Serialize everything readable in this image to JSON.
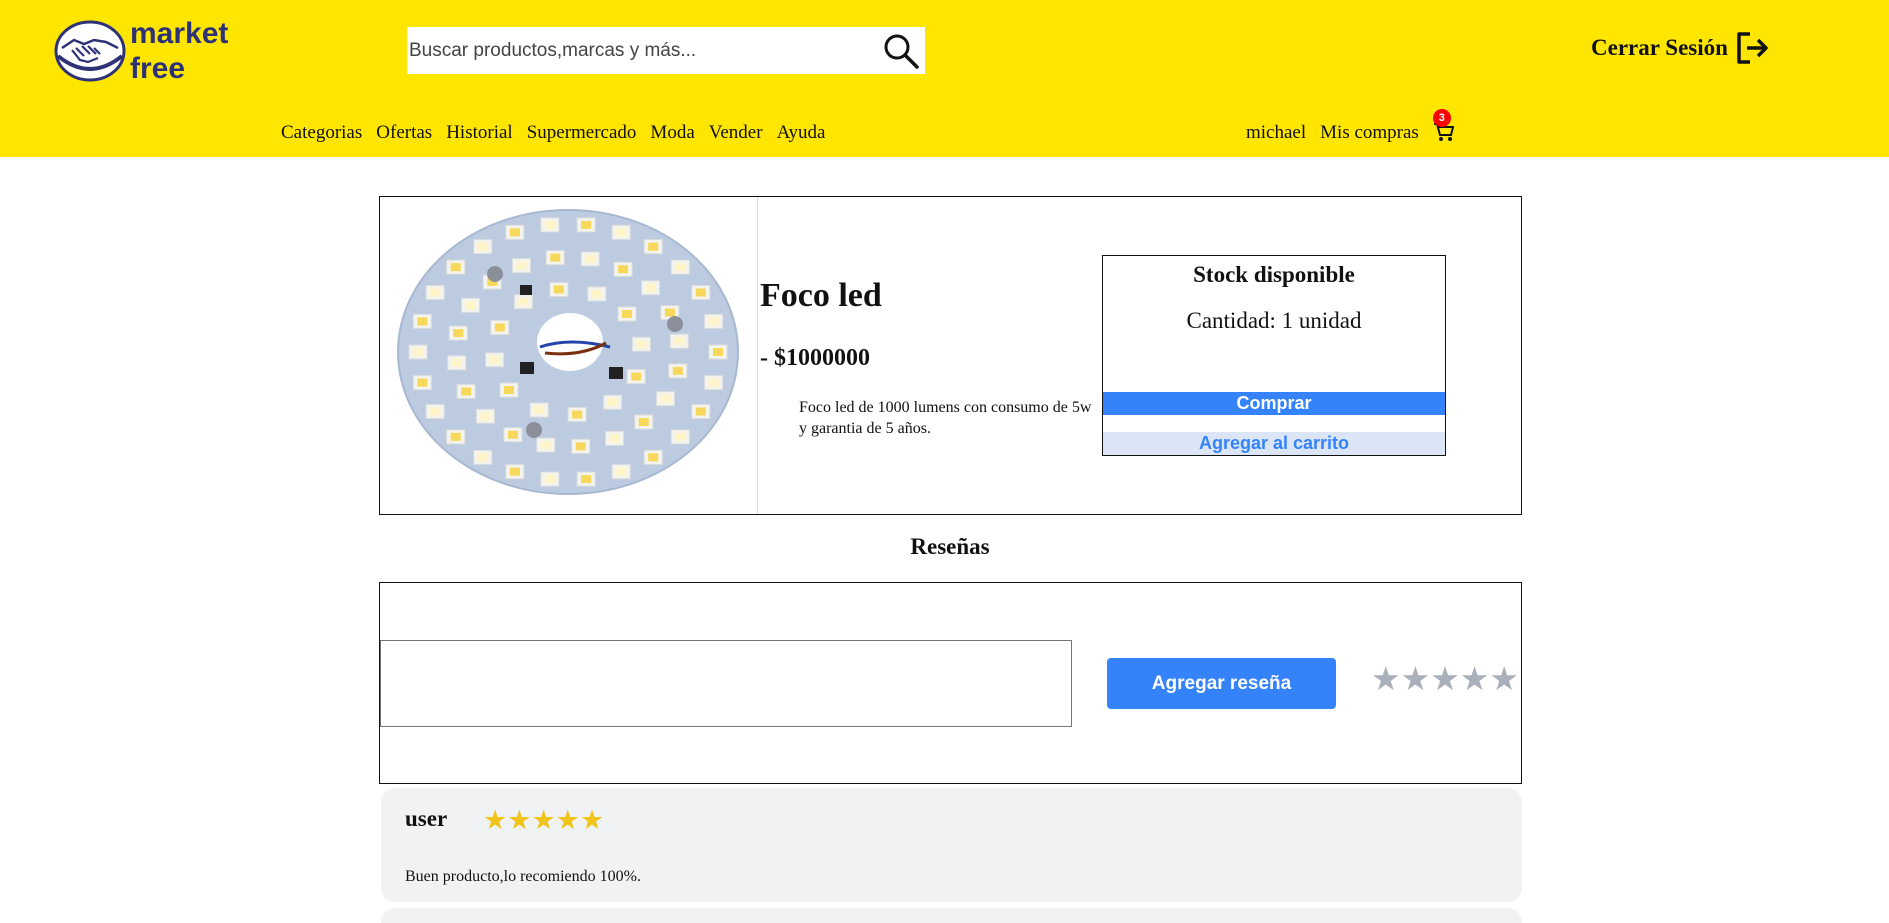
{
  "brand": {
    "line1": "market",
    "line2": "free",
    "icon": "handshake-logo-icon"
  },
  "search": {
    "placeholder": "Buscar productos,marcas y más...",
    "value": "",
    "icon": "search-icon"
  },
  "logout": {
    "label": "Cerrar Sesión",
    "icon": "logout-icon"
  },
  "nav": {
    "items": [
      {
        "label": "Categorias"
      },
      {
        "label": "Ofertas"
      },
      {
        "label": "Historial"
      },
      {
        "label": "Supermercado"
      },
      {
        "label": "Moda"
      },
      {
        "label": "Vender"
      },
      {
        "label": "Ayuda"
      }
    ]
  },
  "user_nav": {
    "username": "michael",
    "purchases": "Mis compras",
    "cart_count": "3",
    "cart_icon": "cart-icon"
  },
  "product": {
    "title": "Foco led",
    "price": "- $1000000",
    "description": "Foco led de 1000 lumens con consumo de 5w y garantia de 5 años.",
    "image": "led-board-image",
    "stock_title": "Stock disponible",
    "quantity": "Cantidad: 1 unidad",
    "buy_label": "Comprar",
    "cart_label": "Agregar al carrito"
  },
  "reviews": {
    "title": "Reseñas",
    "input_value": "",
    "submit_label": "Agregar reseña",
    "rating_stars": [
      "★",
      "★",
      "★",
      "★",
      "★"
    ],
    "rating_selected": 0,
    "items": [
      {
        "user": "user",
        "stars": [
          "★",
          "★",
          "★",
          "★",
          "★"
        ],
        "rating": 5,
        "text": "Buen producto,lo recomiendo 100%."
      }
    ]
  },
  "colors": {
    "header": "#ffe600",
    "primary": "#3483fa",
    "secondary": "#dbe5f5",
    "star_filled": "#f2c318",
    "star_empty": "#aab0bb",
    "badge": "#ff0000"
  }
}
